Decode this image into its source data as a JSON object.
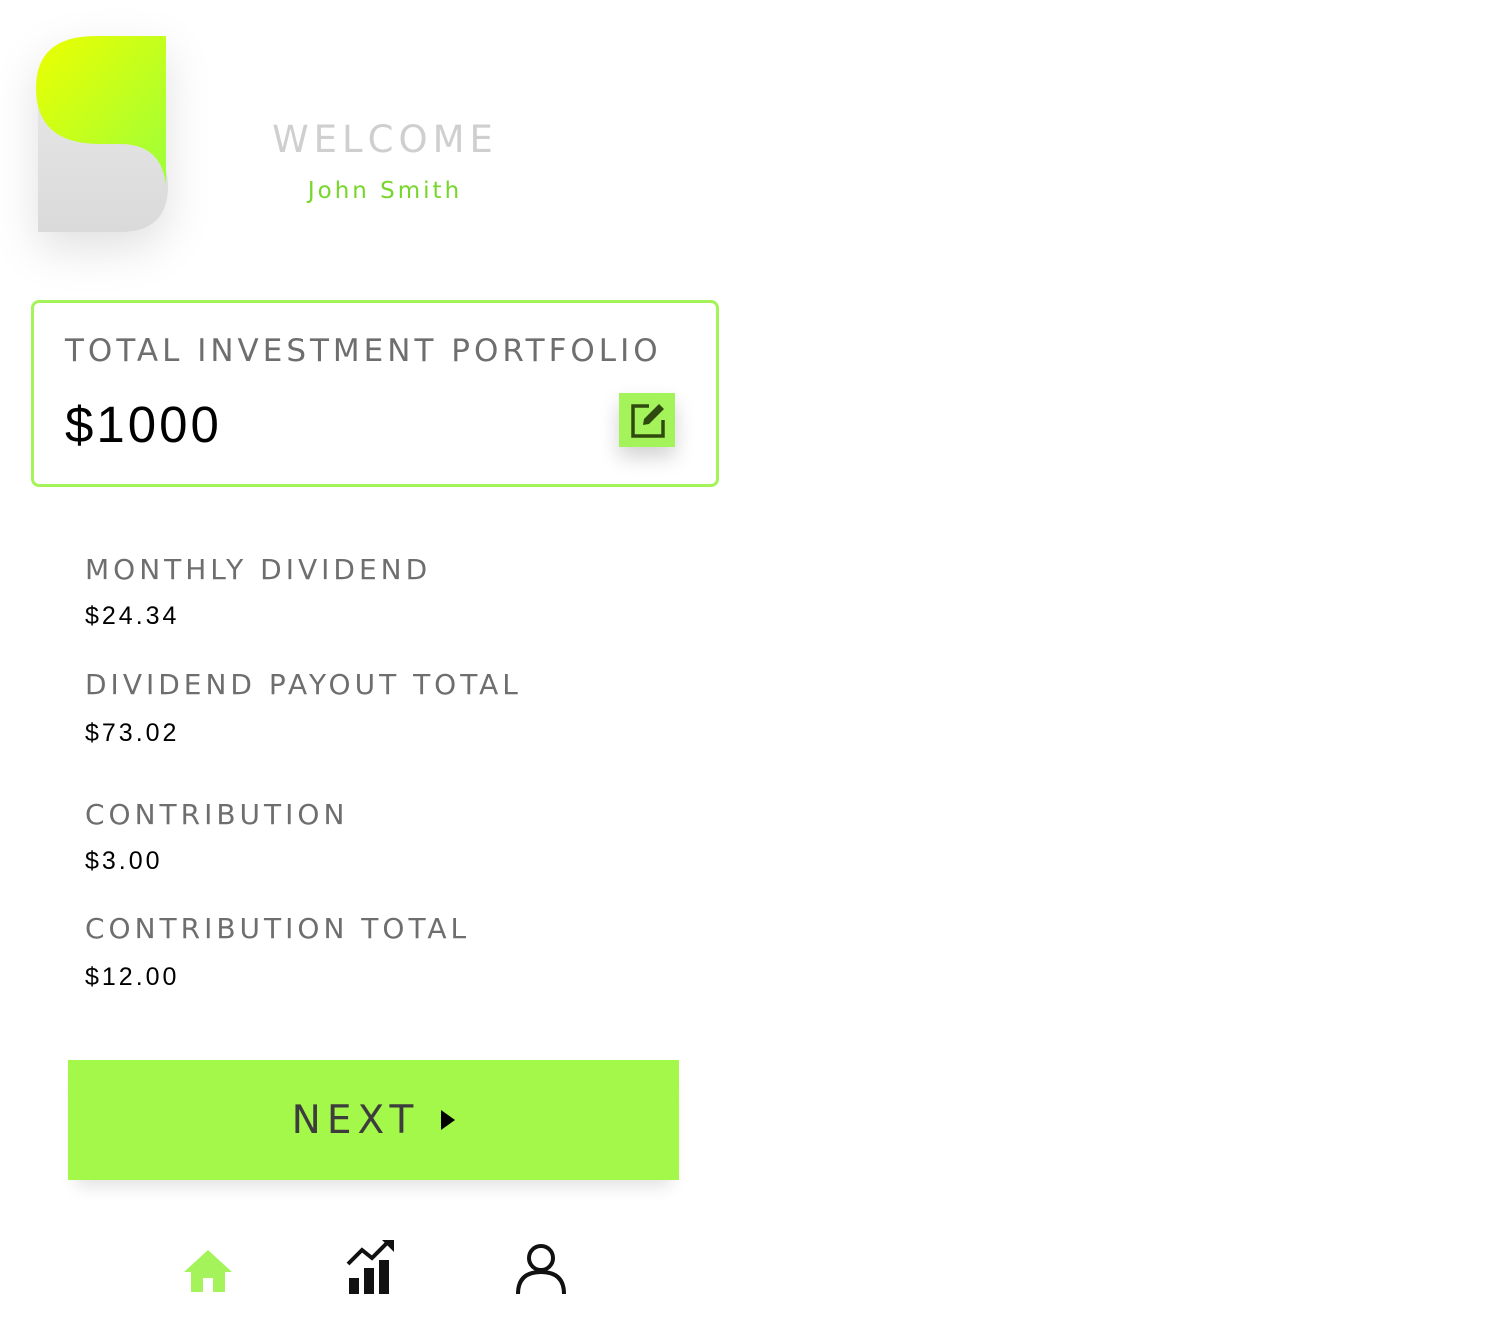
{
  "header": {
    "welcome_title": "WELCOME",
    "user_name": "John Smith"
  },
  "portfolio": {
    "label": "TOTAL INVESTMENT PORTFOLIO",
    "value": "$1000"
  },
  "stats": [
    {
      "label": "MONTHLY DIVIDEND",
      "value": "$24.34"
    },
    {
      "label": "DIVIDEND PAYOUT TOTAL",
      "value": "$73.02"
    },
    {
      "label": "CONTRIBUTION",
      "value": "$3.00"
    },
    {
      "label": "CONTRIBUTION TOTAL",
      "value": "$12.00"
    }
  ],
  "actions": {
    "next_label": "NEXT"
  },
  "nav": {
    "items": [
      {
        "icon": "home-icon",
        "active": true
      },
      {
        "icon": "chart-icon",
        "active": false
      },
      {
        "icon": "user-icon",
        "active": false
      }
    ]
  },
  "colors": {
    "accent": "#a4f35a",
    "accent_text": "#76d72a",
    "logo_gradient_top": "#e6ff00",
    "logo_gradient_bottom": "#9cff3a",
    "logo_gray": "#dcdcdc"
  }
}
